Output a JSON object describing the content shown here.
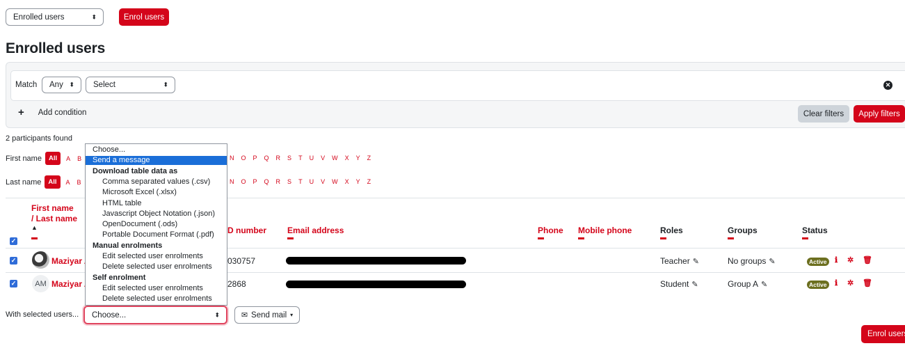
{
  "top": {
    "view_select": "Enrolled users",
    "enrol_button": "Enrol users",
    "page_title": "Enrolled users"
  },
  "filters": {
    "match_label": "Match",
    "match_value": "Any",
    "type_value": "Select",
    "add_condition": "Add condition",
    "clear_filters": "Clear filters",
    "apply_filters": "Apply filters"
  },
  "participants_found": "2 participants found",
  "initials_bar": {
    "first_name_label": "First name",
    "last_name_label": "Last name",
    "all_label": "All",
    "visible_left_letters": [
      "A",
      "B"
    ],
    "visible_right_letters": [
      "N",
      "O",
      "P",
      "Q",
      "R",
      "S",
      "T",
      "U",
      "V",
      "W",
      "X",
      "Y",
      "Z"
    ]
  },
  "table": {
    "headers": {
      "first_name": "First name",
      "last_name_sep": "/ Last name",
      "id_number": "D number",
      "email": "Email address",
      "phone": "Phone",
      "mobile": "Mobile phone",
      "roles": "Roles",
      "groups": "Groups",
      "status": "Status"
    },
    "rows": [
      {
        "name": "Maziyar A",
        "avatar": "photo",
        "id_number": "030757",
        "role": "Teacher",
        "group": "No groups",
        "status": "Active"
      },
      {
        "name": "Maziyar A",
        "avatar_initials": "AM",
        "id_number": "2868",
        "role": "Student",
        "group": "Group A",
        "status": "Active"
      }
    ]
  },
  "bulk": {
    "with_selected_label": "With selected users...",
    "choose_value": "Choose...",
    "send_mail": "Send mail",
    "enrol_users_bottom": "Enrol users"
  },
  "dropdown": {
    "items": [
      {
        "label": "Choose...",
        "kind": "top"
      },
      {
        "label": "Send a message",
        "kind": "top",
        "selected": true
      },
      {
        "label": "Download table data as",
        "kind": "group"
      },
      {
        "label": "Comma separated values (.csv)",
        "kind": "option"
      },
      {
        "label": "Microsoft Excel (.xlsx)",
        "kind": "option"
      },
      {
        "label": "HTML table",
        "kind": "option"
      },
      {
        "label": "Javascript Object Notation (.json)",
        "kind": "option"
      },
      {
        "label": "OpenDocument (.ods)",
        "kind": "option"
      },
      {
        "label": "Portable Document Format (.pdf)",
        "kind": "option"
      },
      {
        "label": "Manual enrolments",
        "kind": "group"
      },
      {
        "label": "Edit selected user enrolments",
        "kind": "option"
      },
      {
        "label": "Delete selected user enrolments",
        "kind": "option"
      },
      {
        "label": "Self enrolment",
        "kind": "group"
      },
      {
        "label": "Edit selected user enrolments",
        "kind": "option"
      },
      {
        "label": "Delete selected user enrolments",
        "kind": "option"
      }
    ]
  },
  "colors": {
    "brand_red": "#d4051a",
    "selected_blue": "#1a6ed8",
    "checkbox_blue": "#2f6cd8",
    "active_badge": "#6c6f1f"
  }
}
